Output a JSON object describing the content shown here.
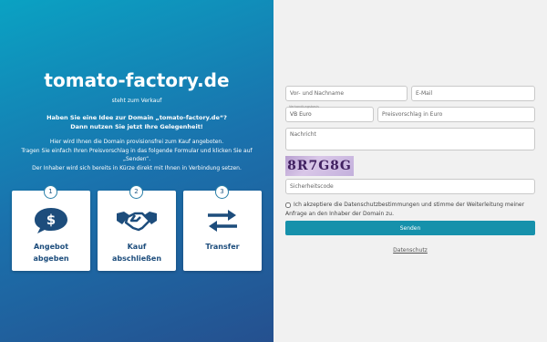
{
  "left": {
    "domain": "tomato-factory.de",
    "for_sale": "steht zum Verkauf",
    "pitch_line1": "Haben Sie eine Idee zur Domain „tomato-factory.de“?",
    "pitch_line2": "Dann nutzen Sie jetzt Ihre Gelegenheit!",
    "desc_line1": "Hier wird Ihnen die Domain provisionsfrei zum Kauf angeboten.",
    "desc_line2": "Tragen Sie einfach Ihren Preisvorschlag in das folgende Formular und klicken Sie auf „Senden“.",
    "desc_line3": "Der Inhaber wird sich bereits in Kürze direkt mit Ihnen in Verbindung setzen.",
    "steps": [
      {
        "number": "1",
        "label_line1": "Angebot",
        "label_line2": "abgeben",
        "icon": "dollar-speech-bubble-icon"
      },
      {
        "number": "2",
        "label_line1": "Kauf",
        "label_line2": "abschließen",
        "icon": "handshake-icon"
      },
      {
        "number": "3",
        "label_line1": "Transfer",
        "label_line2": "",
        "icon": "transfer-arrows-icon"
      }
    ]
  },
  "form": {
    "name_placeholder": "Vor- und Nachname",
    "email_placeholder": "E-Mail",
    "basis_label": "Verhandlungsbasis",
    "basis_value": "VB Euro",
    "offer_placeholder": "Preisvorschlag in Euro",
    "message_placeholder": "Nachricht",
    "captcha_text": "8R7G8G",
    "code_placeholder": "Sicherheitscode",
    "consent_text": "Ich akzeptiere die Datenschutzbestimmungen und stimme der Weiterleitung meiner Anfrage an den Inhaber der Domain zu.",
    "send_label": "Senden",
    "privacy_link": "Datenschutz"
  },
  "colors": {
    "gradient_top": "#0aa2c3",
    "gradient_bottom": "#25508f",
    "step_text": "#1d4d7c",
    "button": "#1691ab"
  }
}
